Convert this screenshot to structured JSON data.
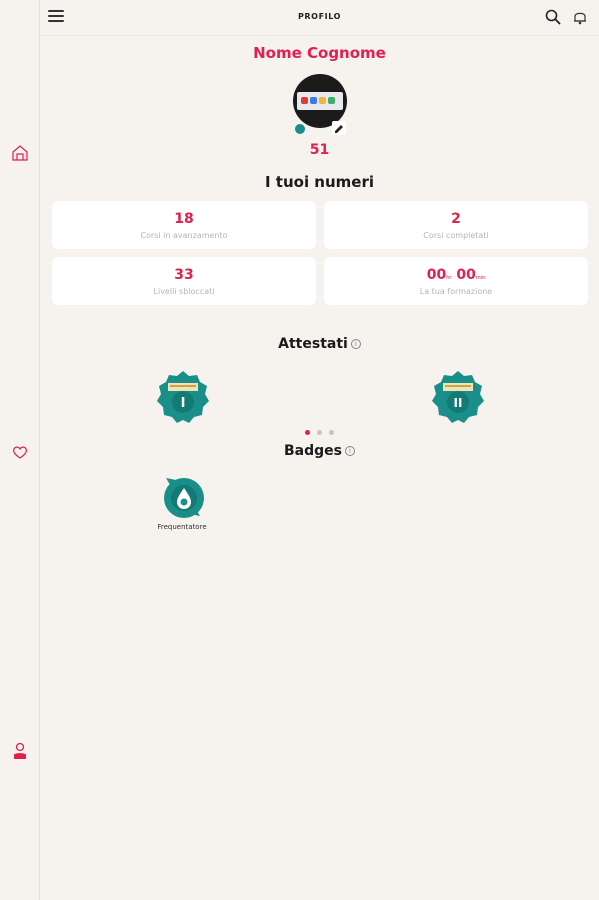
{
  "header": {
    "title": "PROFILO"
  },
  "sidebar": {
    "icons": [
      "home-icon",
      "heart-icon",
      "user-icon"
    ]
  },
  "profile": {
    "name": "Nome Cognome",
    "level": "51"
  },
  "stats": {
    "title": "I tuoi numeri",
    "cards": [
      {
        "value": "18",
        "label": "Corsi in avanzamento"
      },
      {
        "value": "2",
        "label": "Corsi completati"
      },
      {
        "value": "33",
        "label": "Livelli sbloccati"
      },
      {
        "value_hours": "00",
        "hours_unit": "hr",
        "value_minutes": "00",
        "minutes_unit": "min",
        "label": "La tua formazione"
      }
    ]
  },
  "attestati": {
    "title": "Attestati",
    "items": [
      {
        "numeral": "I"
      },
      {
        "numeral": "II"
      }
    ],
    "pagination": {
      "pages": 3,
      "active": 1
    }
  },
  "badges": {
    "title": "Badges",
    "items": [
      {
        "label": "Frequentatore"
      }
    ]
  },
  "colors": {
    "accent": "#e0204d",
    "teal": "#1a8f8a",
    "background": "#f6f2ee"
  }
}
